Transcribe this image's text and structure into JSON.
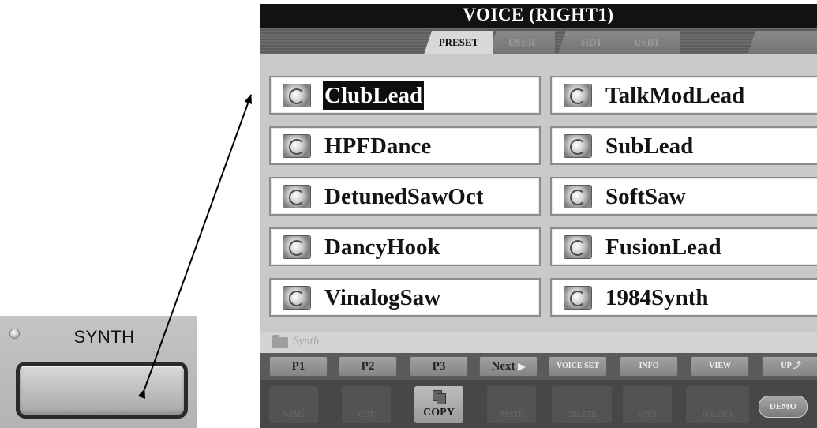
{
  "panel": {
    "synth_label": "SYNTH"
  },
  "screen": {
    "title": "VOICE (RIGHT1)",
    "tabs": [
      {
        "label": "PRESET",
        "active": true
      },
      {
        "label": "USER",
        "active": false
      },
      {
        "label": "HD1",
        "active": false
      },
      {
        "label": "USB1",
        "active": false
      }
    ],
    "voices_left": [
      {
        "name": "ClubLead",
        "selected": true,
        "icon": "synth-voice-icon"
      },
      {
        "name": "HPFDance",
        "selected": false,
        "icon": "synth-voice-icon"
      },
      {
        "name": "DetunedSawOct",
        "selected": false,
        "icon": "synth-voice-icon"
      },
      {
        "name": "DancyHook",
        "selected": false,
        "icon": "synth-voice-icon"
      },
      {
        "name": "VinalogSaw",
        "selected": false,
        "icon": "synth-voice-icon"
      }
    ],
    "voices_right": [
      {
        "name": "TalkModLead",
        "selected": false,
        "icon": "synth-voice-icon"
      },
      {
        "name": "SubLead",
        "selected": false,
        "icon": "synth-voice-icon"
      },
      {
        "name": "SoftSaw",
        "selected": false,
        "icon": "synth-voice-icon"
      },
      {
        "name": "FusionLead",
        "selected": false,
        "icon": "synth-voice-icon"
      },
      {
        "name": "1984Synth",
        "selected": false,
        "icon": "synth-voice-icon"
      }
    ],
    "folder": "Synth",
    "page_buttons": [
      "P1",
      "P2",
      "P3"
    ],
    "next_label": "Next",
    "sub_buttons": [
      "VOICE SET",
      "INFO",
      "VIEW",
      "UP"
    ],
    "function_buttons": [
      "NAME",
      "CUT",
      "COPY",
      "PASTE",
      "DELETE",
      "SAVE",
      "FOLDER"
    ],
    "demo_label": "DEMO"
  }
}
